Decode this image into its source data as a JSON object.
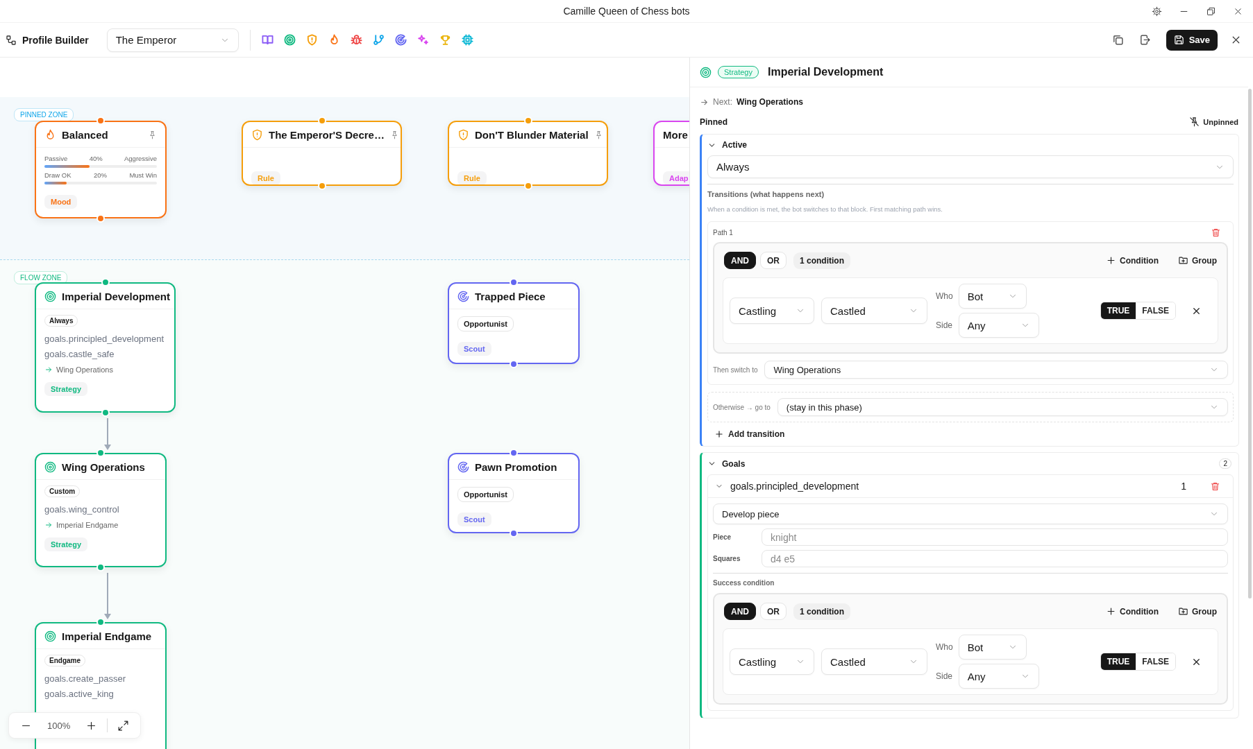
{
  "window": {
    "title": "Camille Queen of Chess bots"
  },
  "toolbar": {
    "app_name": "Profile Builder",
    "profile": "The Emperor",
    "save_label": "Save",
    "block_types": [
      {
        "kind": "book",
        "color": "#8b5cf6"
      },
      {
        "kind": "target",
        "color": "#10b981"
      },
      {
        "kind": "shield",
        "color": "#f59e0b"
      },
      {
        "kind": "flame",
        "color": "#f97316"
      },
      {
        "kind": "bug",
        "color": "#ef4444"
      },
      {
        "kind": "branch",
        "color": "#0ea5e9"
      },
      {
        "kind": "radar",
        "color": "#6366f1"
      },
      {
        "kind": "sparkles",
        "color": "#d946ef"
      },
      {
        "kind": "trophy",
        "color": "#eab308"
      },
      {
        "kind": "cpu",
        "color": "#06b6d4"
      }
    ]
  },
  "canvas": {
    "zoom_level": "100%",
    "zones": [
      {
        "kind": "pinned",
        "label": "PINNED ZONE",
        "nodes": [
          {
            "kind": "mood",
            "title": "Balanced",
            "color": "#f97316",
            "pinned": true,
            "tag": "Mood",
            "sliders": [
              {
                "left": "Passive",
                "value": "40%",
                "right": "Aggressive",
                "level": 0.4
              },
              {
                "left": "Draw OK",
                "value": "20%",
                "right": "Must Win",
                "level": 0.2
              }
            ]
          },
          {
            "kind": "rule",
            "title": "The Emperor'S Decre…",
            "color": "#f59e0b",
            "pinned": true,
            "tag": "Rule"
          },
          {
            "kind": "rule",
            "title": "Don'T Blunder Material",
            "color": "#f59e0b",
            "pinned": true,
            "tag": "Rule"
          },
          {
            "kind": "adaptive",
            "title": "More",
            "color": "#d946ef",
            "tag": "Adap"
          }
        ]
      },
      {
        "kind": "flow",
        "label": "FLOW ZONE",
        "nodes": [
          {
            "kind": "strategy",
            "title": "Imperial Development",
            "color": "#10b981",
            "pinned": false,
            "trigger": "Always",
            "goals": [
              "goals.principled_development",
              "goals.castle_safe"
            ],
            "next": "Wing Operations",
            "tag": "Strategy"
          },
          {
            "kind": "strategy",
            "title": "Wing Operations",
            "color": "#10b981",
            "pinned": false,
            "trigger": "Custom",
            "goals": [
              "goals.wing_control"
            ],
            "next": "Imperial Endgame",
            "tag": "Strategy"
          },
          {
            "kind": "strategy",
            "title": "Imperial Endgame",
            "color": "#10b981",
            "pinned": false,
            "trigger": "Endgame",
            "goals": [
              "goals.create_passer",
              "goals.active_king"
            ]
          },
          {
            "kind": "opportunist",
            "title": "Trapped Piece",
            "color": "#6366f1",
            "pinned": false,
            "pill": "Opportunist",
            "tag": "Scout"
          },
          {
            "kind": "opportunist",
            "title": "Pawn Promotion",
            "color": "#6366f1",
            "pinned": false,
            "pill": "Opportunist",
            "tag": "Scout"
          }
        ]
      }
    ]
  },
  "inspector": {
    "badge": "Strategy",
    "title": "Imperial Development",
    "next_label": "Next:",
    "next_value": "Wing Operations",
    "pinned_label": "Pinned",
    "pin_toggle": "Unpinned",
    "active": {
      "title": "Active",
      "expanded": true,
      "trigger": "Always",
      "transitions_title": "Transitions (what happens next)",
      "transitions_hint": "When a condition is met, the bot switches to that block. First matching path wins.",
      "paths": [
        {
          "label": "Path 1",
          "then_label": "Then switch to",
          "then_value": "Wing Operations",
          "group": {
            "operators": [
              {
                "label": "AND",
                "selected": true
              },
              {
                "label": "OR",
                "selected": false
              }
            ],
            "count": "1 condition",
            "add_condition": "Condition",
            "add_group": "Group",
            "conditions": [
              {
                "type": "Castling",
                "value": "Castled",
                "who_label": "Who",
                "who": "Bot",
                "side_label": "Side",
                "side": "Any",
                "truth": [
                  {
                    "label": "TRUE",
                    "selected": true
                  },
                  {
                    "label": "FALSE",
                    "selected": false
                  }
                ]
              }
            ]
          }
        }
      ],
      "otherwise_label": "Otherwise → go to",
      "otherwise_value": "(stay in this phase)",
      "add_label": "Add transition"
    },
    "goals": {
      "title": "Goals",
      "count": "2",
      "expanded": true,
      "items": [
        {
          "name": "goals.principled_development",
          "priority": "1",
          "expanded": true,
          "action": "Develop piece",
          "params": [
            {
              "label": "Piece",
              "placeholder": "knight"
            },
            {
              "label": "Squares",
              "placeholder": "d4 e5"
            }
          ],
          "success_label": "Success condition",
          "group": {
            "operators": [
              {
                "label": "AND",
                "selected": true
              },
              {
                "label": "OR",
                "selected": false
              }
            ],
            "count": "1 condition",
            "add_condition": "Condition",
            "add_group": "Group",
            "conditions": [
              {
                "type": "Castling",
                "value": "Castled",
                "who_label": "Who",
                "who": "Bot",
                "side_label": "Side",
                "side": "Any",
                "truth": [
                  {
                    "label": "TRUE",
                    "selected": true
                  },
                  {
                    "label": "FALSE",
                    "selected": false
                  }
                ]
              }
            ]
          }
        }
      ]
    }
  }
}
